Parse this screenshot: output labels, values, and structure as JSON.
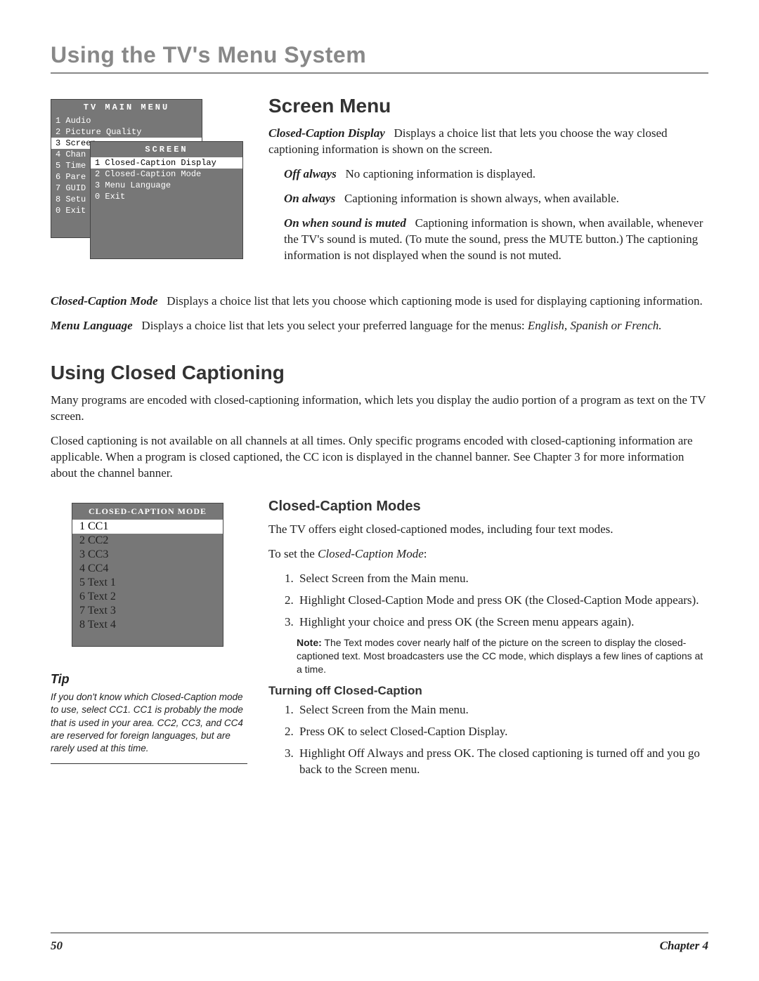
{
  "chapter_title": "Using the TV's Menu System",
  "osd_main": {
    "title": "TV MAIN MENU",
    "items": [
      {
        "n": "1",
        "label": "Audio"
      },
      {
        "n": "2",
        "label": "Picture Quality"
      },
      {
        "n": "3",
        "label": "Screen",
        "selected": true
      },
      {
        "n": "4",
        "label": "Chan"
      },
      {
        "n": "5",
        "label": "Time"
      },
      {
        "n": "6",
        "label": "Pare"
      },
      {
        "n": "7",
        "label": "GUID"
      },
      {
        "n": "8",
        "label": "Setu"
      },
      {
        "n": "0",
        "label": "Exit"
      }
    ]
  },
  "osd_screen": {
    "title": "SCREEN",
    "items": [
      {
        "n": "1",
        "label": "Closed-Caption Display",
        "selected": true
      },
      {
        "n": "2",
        "label": "Closed-Caption Mode"
      },
      {
        "n": "3",
        "label": "Menu Language"
      },
      {
        "n": "0",
        "label": "Exit"
      }
    ]
  },
  "screen_menu": {
    "heading": "Screen Menu",
    "ccd_lead": "Closed-Caption Display",
    "ccd_text": "Displays a choice list that lets you choose the way closed captioning information is shown on the screen.",
    "off_lead": "Off always",
    "off_text": "No captioning information is displayed.",
    "on_lead": "On always",
    "on_text": "Captioning information is shown always, when available.",
    "muted_lead": "On when sound is muted",
    "muted_text": "Captioning information is shown, when available, whenever the TV's sound is muted. (To mute the sound, press the MUTE button.) The captioning information is not displayed when the sound is not muted.",
    "ccm_lead": "Closed-Caption Mode",
    "ccm_text": "Displays a choice list that lets you choose which captioning mode is used for displaying captioning information.",
    "ml_lead": "Menu Language",
    "ml_text_1": "Displays a choice list that lets you select your preferred language for the menus: ",
    "ml_langs": "English, Spanish or French."
  },
  "closed_captioning": {
    "heading": "Using Closed Captioning",
    "p1": "Many programs are encoded with closed-captioning information, which lets you display the audio portion of a program as text on the TV screen.",
    "p2": "Closed captioning is not available on all channels at all times. Only specific programs encoded with closed-captioning information are applicable. When a program is closed captioned, the CC icon is displayed in the channel banner. See Chapter 3 for more information about the channel banner."
  },
  "osd_cc": {
    "title": "CLOSED-CAPTION MODE",
    "items": [
      {
        "n": "1",
        "label": "CC1",
        "selected": true
      },
      {
        "n": "2",
        "label": "CC2"
      },
      {
        "n": "3",
        "label": "CC3"
      },
      {
        "n": "4",
        "label": "CC4"
      },
      {
        "n": "5",
        "label": "Text 1"
      },
      {
        "n": "6",
        "label": "Text 2"
      },
      {
        "n": "7",
        "label": "Text 3"
      },
      {
        "n": "8",
        "label": "Text 4"
      }
    ]
  },
  "tip": {
    "heading": "Tip",
    "body": "If you don't know which Closed-Caption mode to use, select CC1. CC1 is probably the mode that is used in your area. CC2, CC3, and CC4  are reserved for foreign languages, but are rarely used at this time."
  },
  "cc_modes": {
    "heading": "Closed-Caption Modes",
    "p1": "The TV offers eight closed-captioned modes, including four text modes.",
    "p2_pre": "To set the ",
    "p2_em": "Closed-Caption Mode",
    "p2_post": ":",
    "steps": [
      "Select Screen from the Main menu.",
      "Highlight Closed-Caption Mode and press OK  (the Closed-Caption Mode appears).",
      "Highlight your choice and press OK (the Screen menu appears again)."
    ],
    "note_lead": "Note:",
    "note_text": " The Text modes cover nearly half of the picture on the screen to display the closed-captioned text. Most broadcasters use the CC mode, which displays a few lines of captions at a time."
  },
  "turn_off": {
    "heading": "Turning off Closed-Caption",
    "steps": [
      "Select Screen from the Main menu.",
      "Press OK to select Closed-Caption Display.",
      "Highlight Off Always and press OK. The closed captioning is turned off and you go back to the Screen menu."
    ]
  },
  "footer": {
    "page": "50",
    "chapter": "Chapter 4"
  }
}
